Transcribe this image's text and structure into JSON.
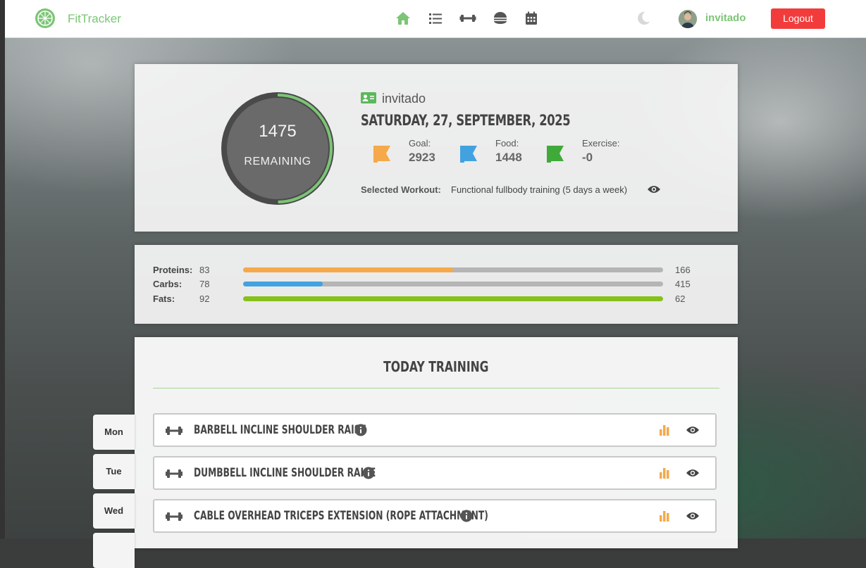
{
  "app": {
    "brand": "FitTracker"
  },
  "nav": {
    "items": [
      {
        "name": "home",
        "icon": "home-icon",
        "active": true
      },
      {
        "name": "list",
        "icon": "list-icon"
      },
      {
        "name": "workouts",
        "icon": "dumbbell-icon"
      },
      {
        "name": "food",
        "icon": "food-icon"
      },
      {
        "name": "calendar",
        "icon": "calendar-icon"
      }
    ],
    "theme_icon": "moon-icon",
    "username": "invitado",
    "logout_label": "Logout"
  },
  "summary": {
    "remaining_value": "1475",
    "remaining_label": "REMAINING",
    "profile_name": "invitado",
    "date": "Saturday, 27, September, 2025",
    "goal_label": "Goal:",
    "goal_value": "2923",
    "food_label": "Food:",
    "food_value": "1448",
    "exercise_label": "Exercise:",
    "exercise_value": "-0",
    "workout_label": "Selected Workout:",
    "workout_value": "Functional fullbody training (5 days a week)"
  },
  "macros": [
    {
      "label": "Proteins:",
      "value": "83",
      "max": "166",
      "fraction": 0.5,
      "color": "#f5a94a"
    },
    {
      "label": "Carbs:",
      "value": "78",
      "max": "415",
      "fraction": 0.19,
      "color": "#42a2e0"
    },
    {
      "label": "Fats:",
      "value": "92",
      "max": "62",
      "fraction": 1.0,
      "color": "#86c11a"
    }
  ],
  "training": {
    "title": "Today Training",
    "exercises": [
      {
        "name": "Barbell Incline Shoulder Raise"
      },
      {
        "name": "Dumbbell Incline Shoulder Raise"
      },
      {
        "name": "Cable Overhead Triceps Extension (Rope Attachment)"
      }
    ]
  },
  "days": [
    "Mon",
    "Tue",
    "Wed"
  ],
  "colors": {
    "accent": "#7cc576",
    "logout": "#f23c3c",
    "goal_flag": "#f5a94a",
    "food_flag": "#42a2e0",
    "exercise_flag": "#3faa3a"
  }
}
